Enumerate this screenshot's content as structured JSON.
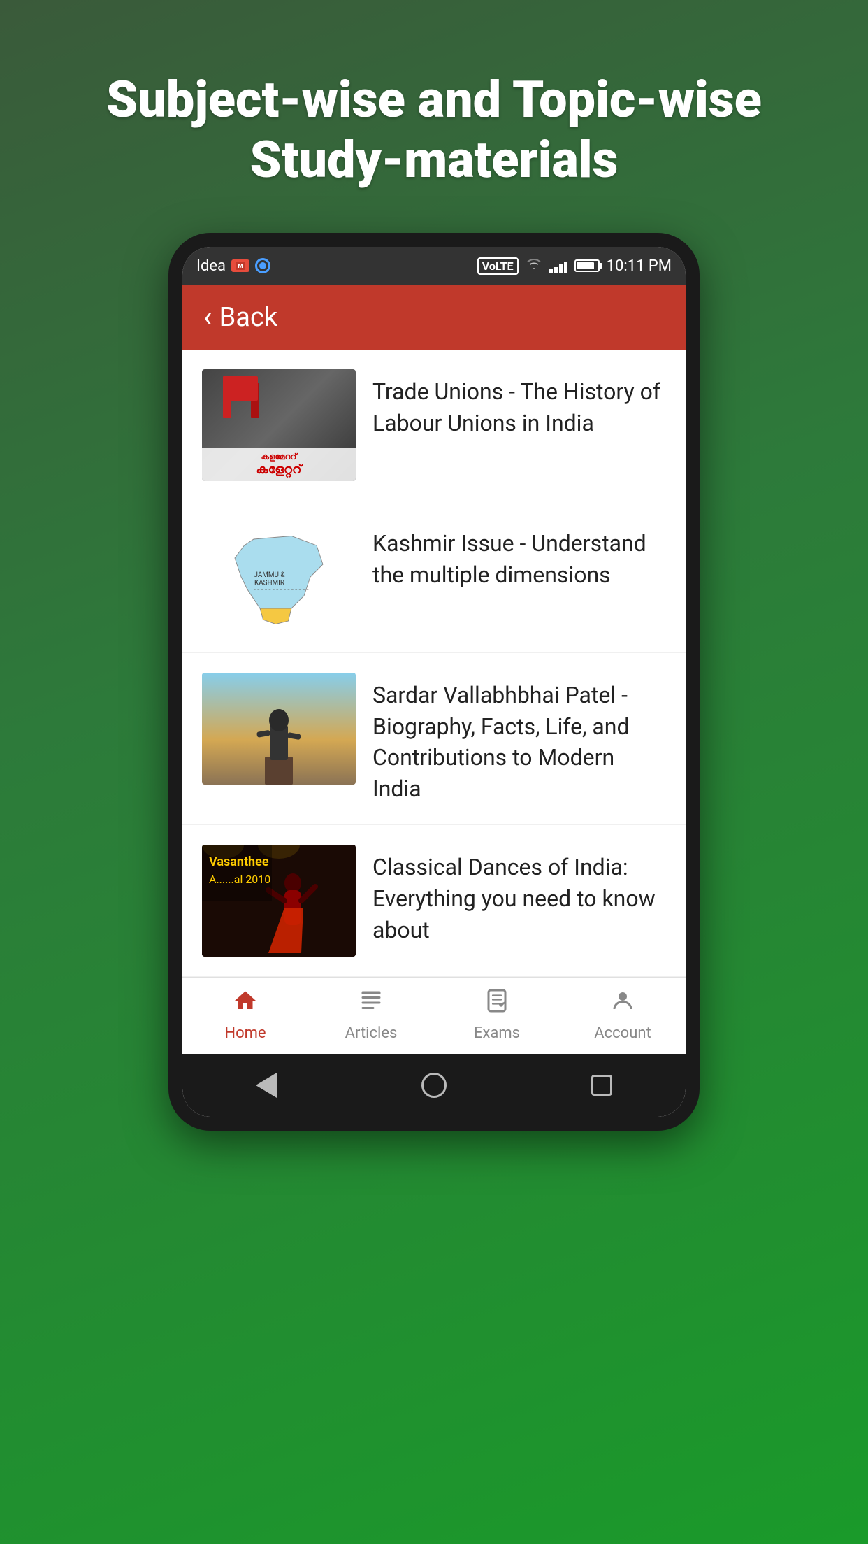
{
  "page": {
    "background_title": "Subject-wise and Topic-wise Study-materials",
    "status_bar": {
      "carrier": "Idea",
      "time": "10:11 PM"
    },
    "app_bar": {
      "back_label": "Back"
    },
    "articles": [
      {
        "id": "article-1",
        "title": "Trade Unions - The History of Labour Unions in India",
        "image_type": "trade-unions"
      },
      {
        "id": "article-2",
        "title": "Kashmir Issue - Understand the multiple dimensions",
        "image_type": "kashmir"
      },
      {
        "id": "article-3",
        "title": "Sardar Vallabhbhai Patel - Biography, Facts, Life, and Contributions to Modern India",
        "image_type": "patel"
      },
      {
        "id": "article-4",
        "title": "Classical Dances of India: Everything you need to know about",
        "image_type": "dance"
      }
    ],
    "bottom_nav": {
      "items": [
        {
          "id": "home",
          "label": "Home",
          "active": true
        },
        {
          "id": "articles",
          "label": "Articles",
          "active": false
        },
        {
          "id": "exams",
          "label": "Exams",
          "active": false
        },
        {
          "id": "account",
          "label": "Account",
          "active": false
        }
      ]
    },
    "colors": {
      "primary_red": "#c0392b",
      "active_nav": "#c0392b",
      "bg_gradient_start": "#3a5a3a",
      "bg_gradient_end": "#1a9a2a"
    }
  }
}
